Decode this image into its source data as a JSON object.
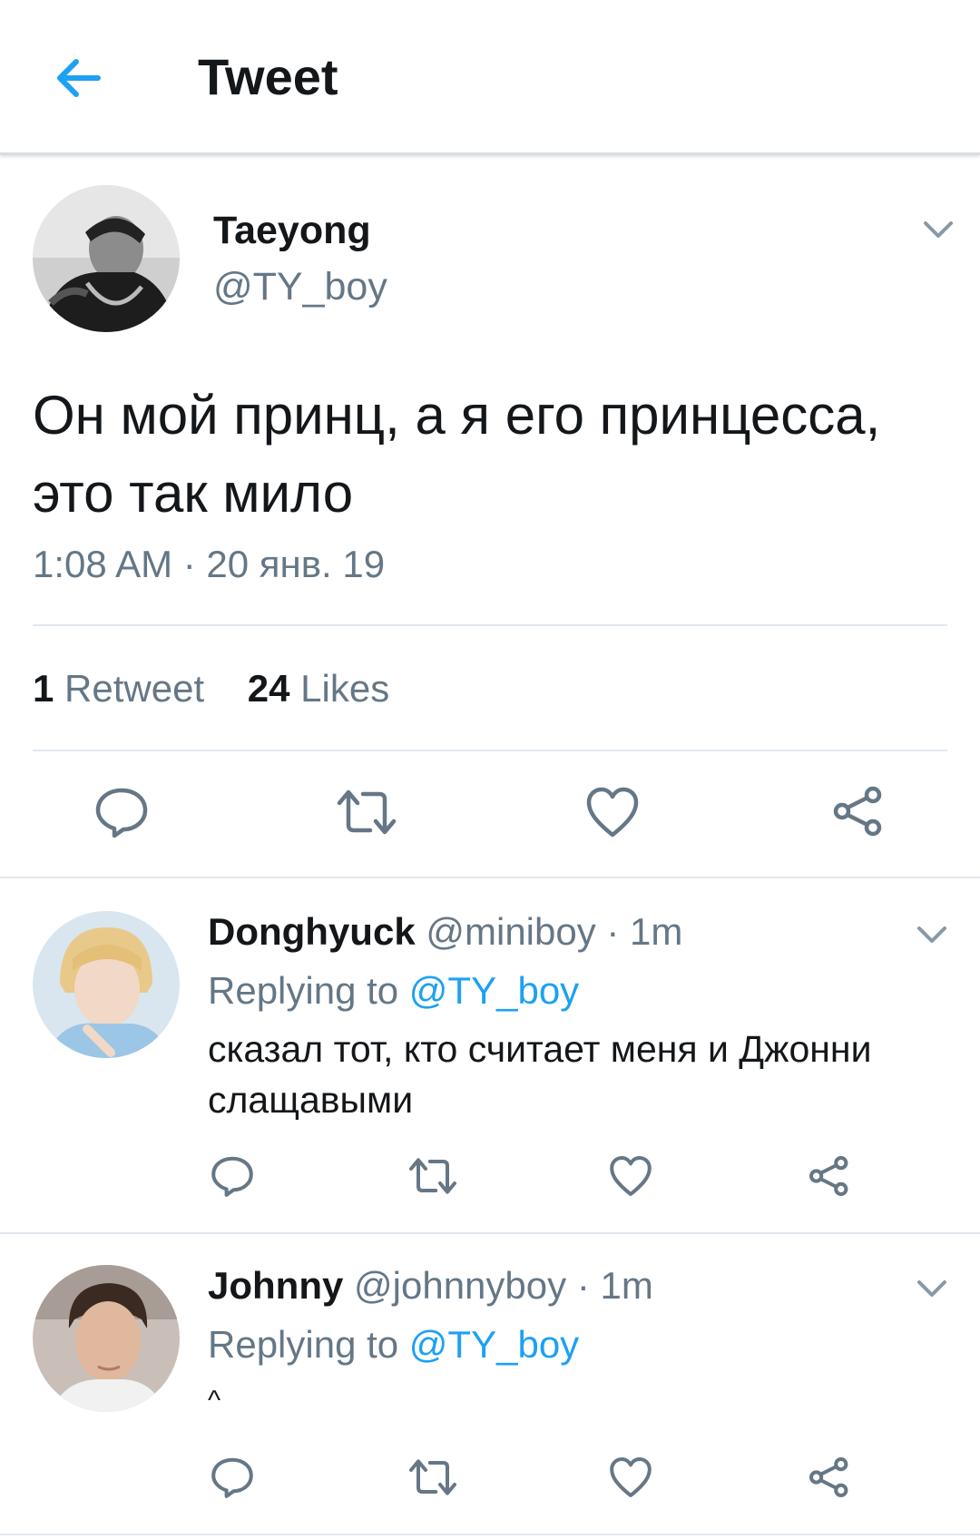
{
  "header": {
    "title": "Tweet",
    "back_icon": "arrow-left-icon",
    "accent": "#1da1f2"
  },
  "tweet": {
    "author_name": "Taeyong",
    "author_handle": "@TY_boy",
    "text": "Он мой принц, а я его принцесса, это так мило",
    "timestamp": "1:08 AM · 20 янв. 19",
    "retweets_count": "1",
    "retweets_label": "Retweet",
    "likes_count": "24",
    "likes_label": "Likes"
  },
  "actions": [
    "reply-icon",
    "retweet-icon",
    "like-icon",
    "share-icon"
  ],
  "replies": [
    {
      "name": "Donghyuck",
      "handle": "@miniboy",
      "time": "· 1m",
      "replying_prefix": "Replying to",
      "replying_to": "@TY_boy",
      "text": "сказал тот, кто считает меня и Джонни слащавыми"
    },
    {
      "name": "Johnny",
      "handle": "@johnnyboy",
      "time": "· 1m",
      "replying_prefix": "Replying to",
      "replying_to": "@TY_boy",
      "text": "^"
    }
  ]
}
